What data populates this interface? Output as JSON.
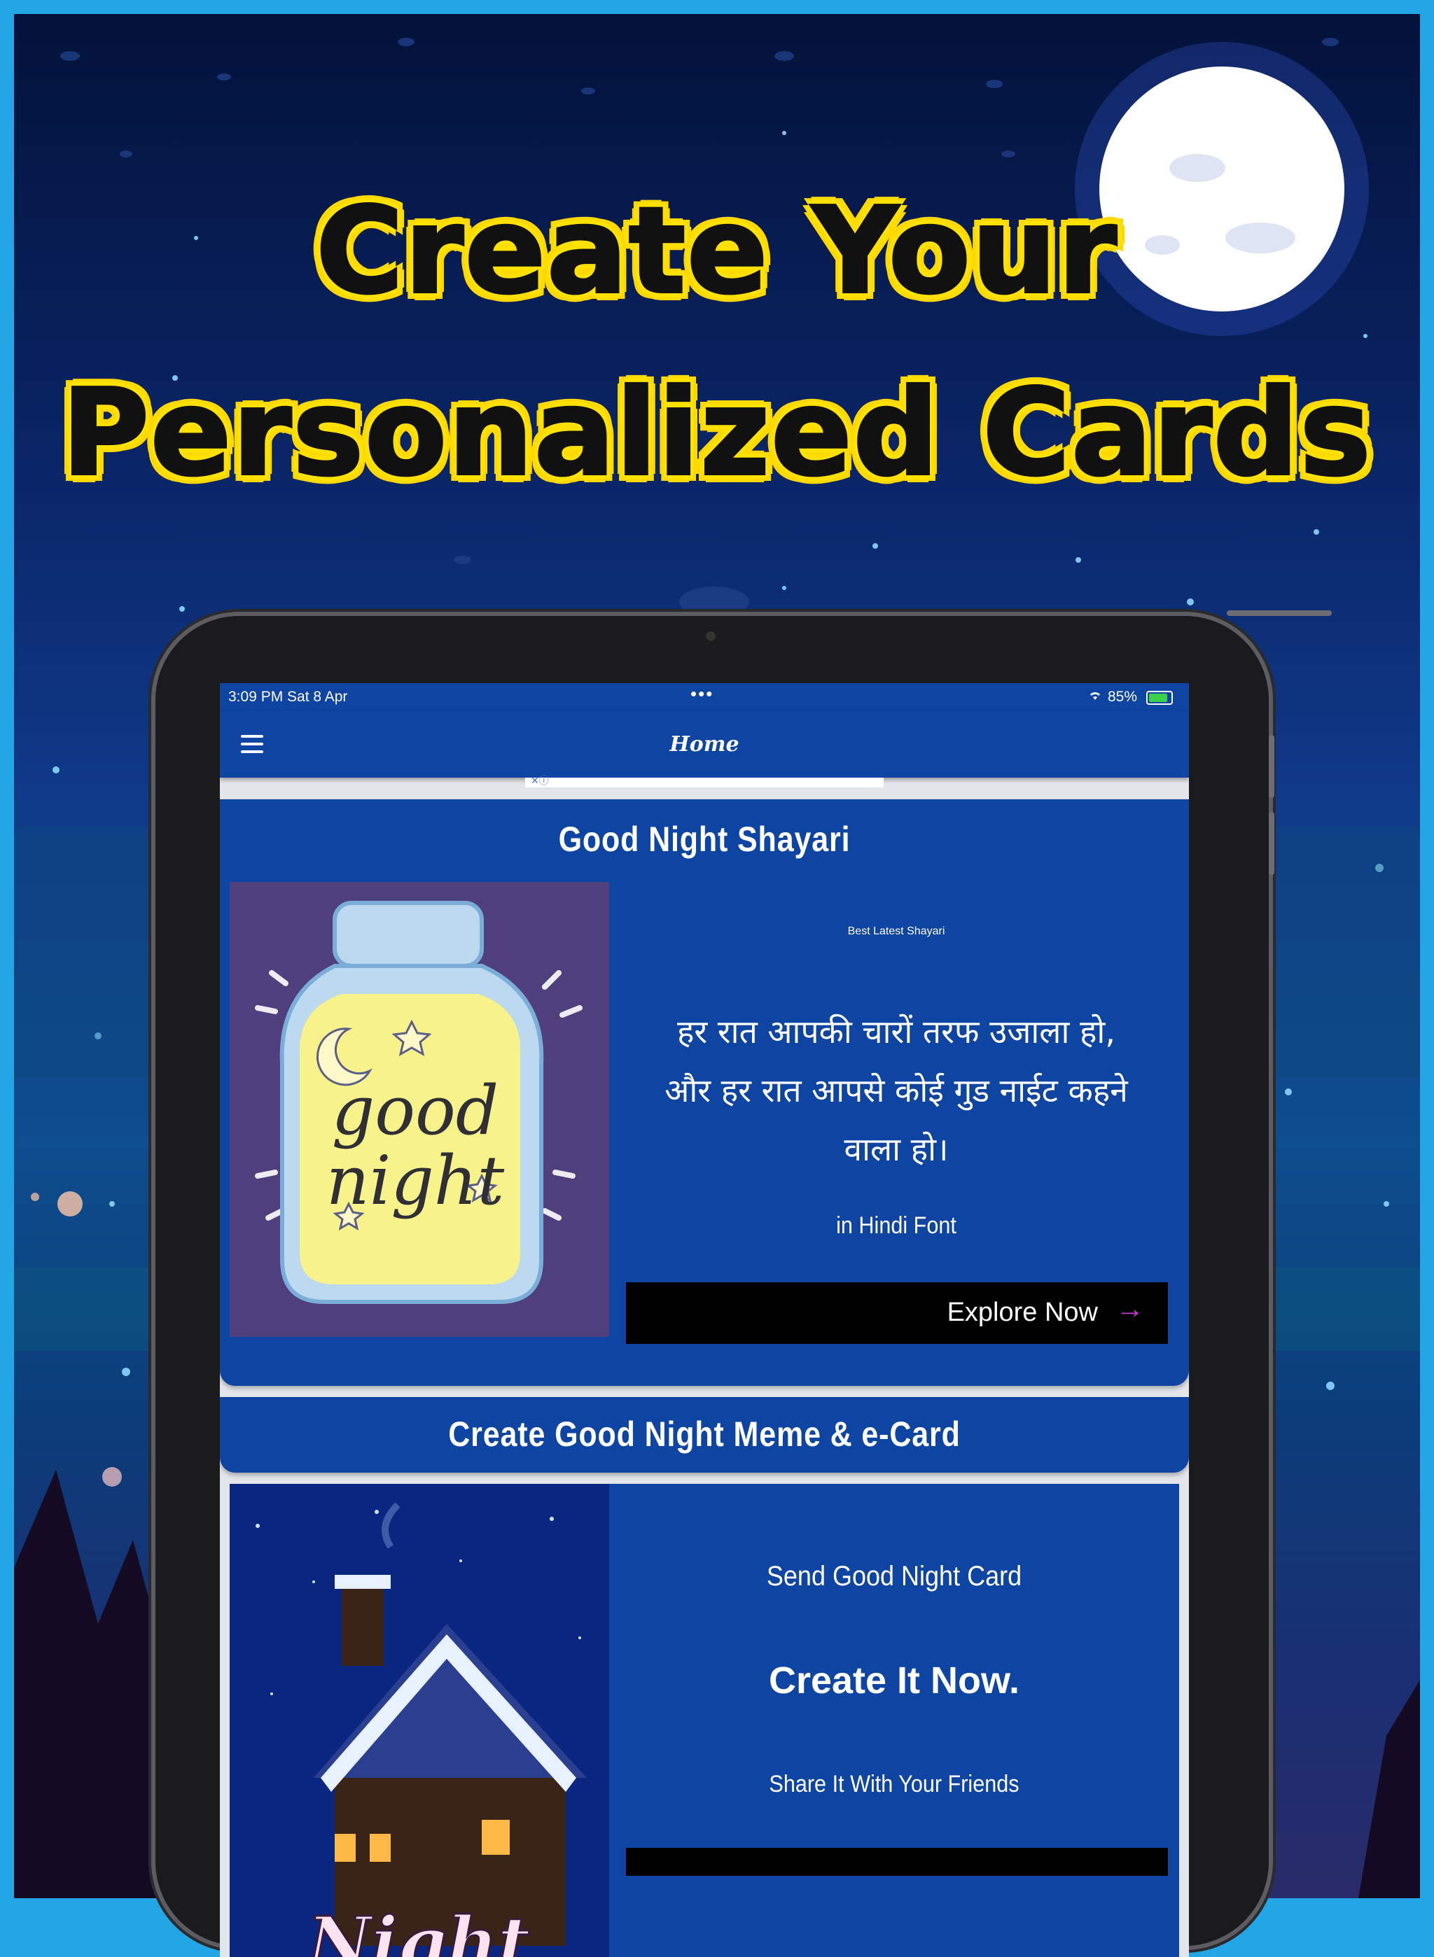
{
  "headline": {
    "line1": "Create Your",
    "line2": "Personalized Cards"
  },
  "status_bar": {
    "time": "3:09 PM   Sat 8 Apr",
    "dots": "•••",
    "battery": "85%"
  },
  "app_bar": {
    "title": "Home",
    "menu_icon": "hamburger-menu-icon"
  },
  "cards": [
    {
      "title": "Good Night Shayari",
      "image": "good-night-jar-illustration",
      "image_text": [
        "good",
        "night"
      ],
      "subtitle": "Best Latest Shayari",
      "hindi_lines": [
        "हर रात आपकी चारों तरफ उजाला हो,",
        "और हर रात आपसे कोई गुड नाईट कहने",
        "वाला हो।"
      ],
      "footnote": "in Hindi Font",
      "cta_label": "Explore Now",
      "cta_icon": "arrow-right-icon"
    },
    {
      "title": "Create Good Night Meme & e-Card",
      "image": "snowy-house-night-illustration",
      "image_text": "Night",
      "subtitle": "Send Good Night Card",
      "headline": "Create It Now.",
      "footnote": "Share It With Your Friends"
    }
  ],
  "colors": {
    "frame": "#22a6e6",
    "app_blue": "#0e44a2",
    "headline_yellow": "#ffe100",
    "cta_arrow": "#c53bd8"
  }
}
